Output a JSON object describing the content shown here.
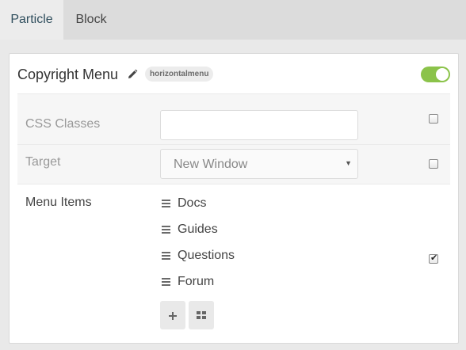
{
  "tabs": [
    {
      "label": "Particle",
      "active": true
    },
    {
      "label": "Block",
      "active": false
    }
  ],
  "panel": {
    "title": "Copyright Menu",
    "badge": "horizontalmenu",
    "enabled": true,
    "toggle_color": "#8bc34a"
  },
  "fields": {
    "css_classes": {
      "label": "CSS Classes",
      "value": "",
      "checked": false
    },
    "target": {
      "label": "Target",
      "selected": "New Window",
      "checked": false
    },
    "menu_items": {
      "label": "Menu Items",
      "checked": true,
      "items": [
        "Docs",
        "Guides",
        "Questions",
        "Forum"
      ]
    }
  },
  "icons": {
    "edit": "pencil-icon",
    "drag": "grip-icon",
    "add": "plus-icon",
    "collection": "grid-icon"
  }
}
